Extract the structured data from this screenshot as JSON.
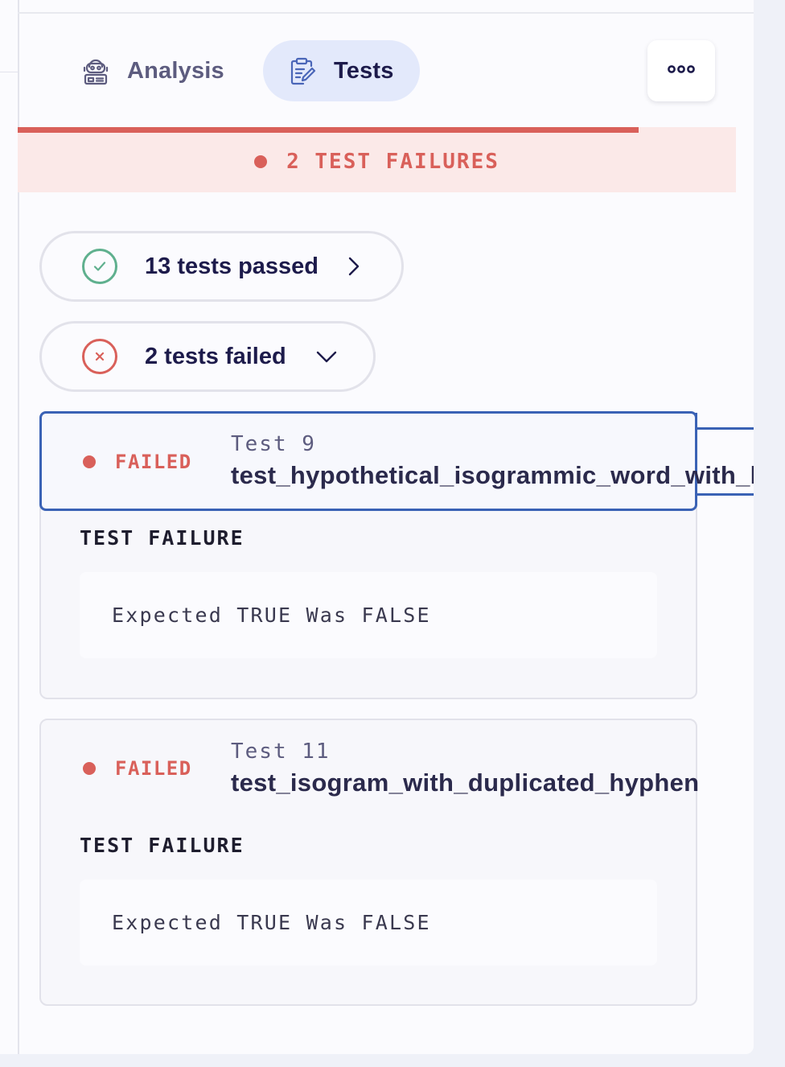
{
  "tabs": {
    "analysis": {
      "label": "Analysis",
      "icon": "robot-icon"
    },
    "tests": {
      "label": "Tests",
      "icon": "clipboard-edit-icon",
      "active": true
    }
  },
  "more_button": {
    "icon": "more-options-icon"
  },
  "banner": {
    "text": "2 TEST FAILURES",
    "progress": 0.865,
    "color": "#d9605a"
  },
  "summary": {
    "passed": {
      "label": "13 tests passed",
      "icon": "check-circle-icon",
      "chevron": "chevron-right-icon"
    },
    "failed": {
      "label": "2 tests failed",
      "icon": "x-circle-icon",
      "chevron": "chevron-down-icon"
    }
  },
  "failures": [
    {
      "status": "FAILED",
      "number": "Test 9",
      "name": "test_hypothetical_isogrammic_word_with_hyphen",
      "section_title": "TEST FAILURE",
      "message": "Expected TRUE Was FALSE"
    },
    {
      "status": "FAILED",
      "number": "Test 11",
      "name": "test_isogram_with_duplicated_hyphen",
      "section_title": "TEST FAILURE",
      "message": "Expected TRUE Was FALSE"
    }
  ],
  "colors": {
    "fail": "#d9605a",
    "pass": "#5fb08e",
    "accent": "#3a62b5",
    "active_tab": "#e3e9fb"
  }
}
